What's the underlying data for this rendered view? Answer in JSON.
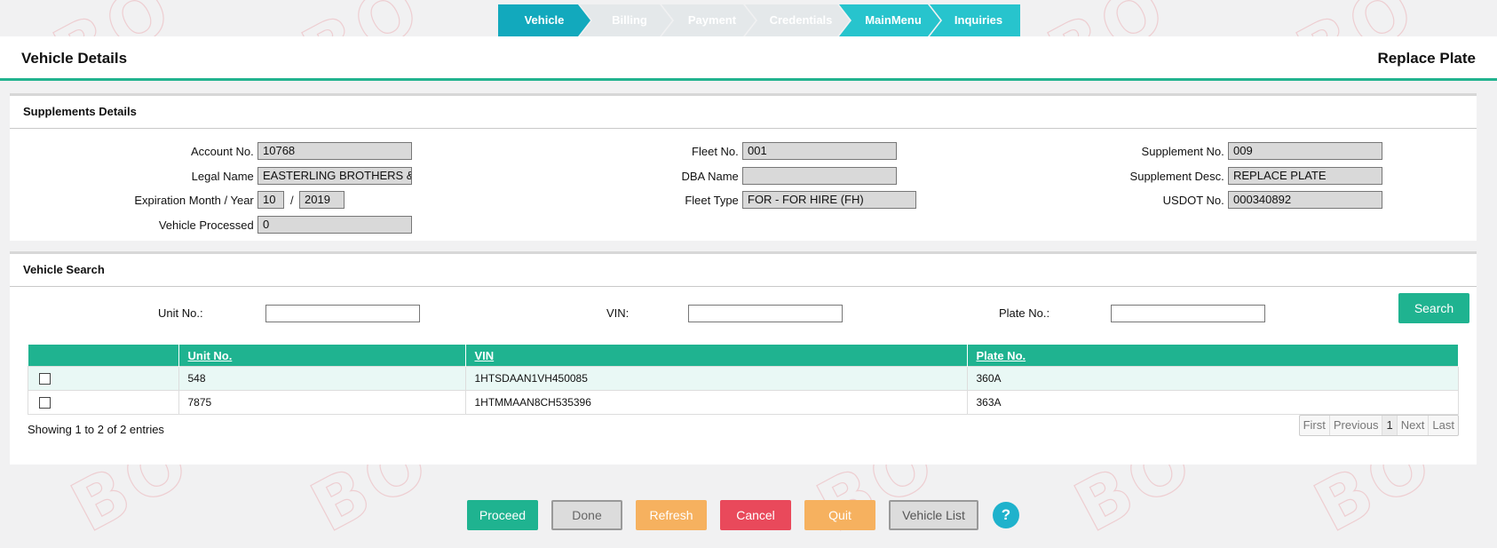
{
  "stepper": [
    {
      "label": "Vehicle",
      "state": "active"
    },
    {
      "label": "Billing",
      "state": "disabled"
    },
    {
      "label": "Payment",
      "state": "disabled"
    },
    {
      "label": "Credentials",
      "state": "disabled"
    },
    {
      "label": "MainMenu",
      "state": "enabled"
    },
    {
      "label": "Inquiries",
      "state": "enabled"
    }
  ],
  "header": {
    "title": "Vehicle Details",
    "right": "Replace Plate"
  },
  "supplements": {
    "title": "Supplements Details",
    "account_label": "Account No. :",
    "account_value": "10768",
    "legal_label": "Legal Name :",
    "legal_value": "EASTERLING BROTHERS & S",
    "exp_label": "Expiration Month / Year :",
    "exp_month": "10",
    "exp_sep": "/",
    "exp_year": "2019",
    "vp_label": "Vehicle Processed :",
    "vp_value": "0",
    "fleet_label": "Fleet No. :",
    "fleet_value": "001",
    "dba_label": "DBA Name :",
    "dba_value": "",
    "ftype_label": "Fleet Type :",
    "ftype_value": "FOR - FOR HIRE (FH)",
    "supno_label": "Supplement No. :",
    "supno_value": "009",
    "supdesc_label": "Supplement Desc. :",
    "supdesc_value": "REPLACE PLATE",
    "usdot_label": "USDOT No. :",
    "usdot_value": "000340892"
  },
  "search": {
    "title": "Vehicle Search",
    "unit_label": "Unit No.:",
    "vin_label": "VIN:",
    "plate_label": "Plate No.:",
    "unit_value": "",
    "vin_value": "",
    "plate_value": "",
    "button": "Search"
  },
  "table": {
    "headers": [
      "Unit No.",
      "VIN",
      "Plate No."
    ],
    "rows": [
      {
        "unit": "548",
        "vin": "1HTSDAAN1VH450085",
        "plate": "360A"
      },
      {
        "unit": "7875",
        "vin": "1HTMMAAN8CH535396",
        "plate": "363A"
      }
    ],
    "showing": "Showing 1 to 2 of 2 entries",
    "pager": {
      "first": "First",
      "previous": "Previous",
      "current": "1",
      "next": "Next",
      "last": "Last"
    }
  },
  "buttons": {
    "proceed": "Proceed",
    "done": "Done",
    "refresh": "Refresh",
    "cancel": "Cancel",
    "quit": "Quit",
    "vehicle_list": "Vehicle List",
    "help": "?"
  },
  "watermark": "BO",
  "colors": {
    "accent": "#1fb390",
    "stepper_active": "#12a9bd",
    "cancel": "#e9495b",
    "warning": "#f6b15f"
  }
}
